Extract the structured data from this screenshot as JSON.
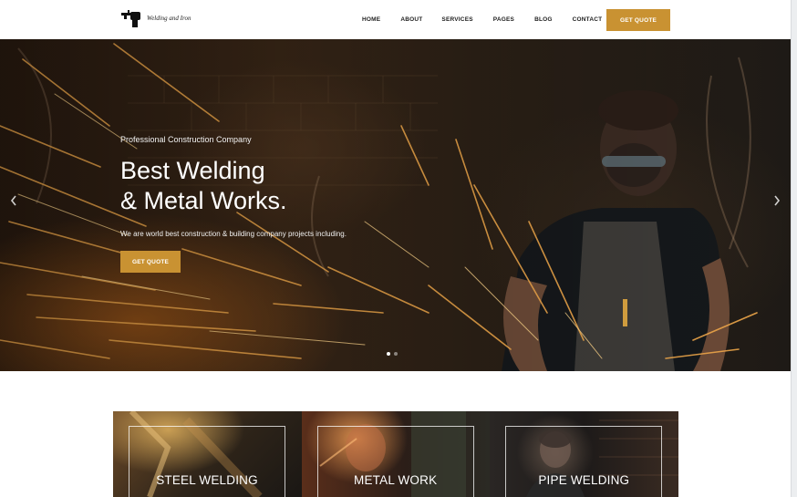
{
  "brand": {
    "name": "Welding and Iron",
    "logo_icon": "welder-logo-icon"
  },
  "nav": {
    "items": [
      {
        "label": "HOME"
      },
      {
        "label": "ABOUT"
      },
      {
        "label": "SERVICES"
      },
      {
        "label": "PAGES"
      },
      {
        "label": "BLOG"
      },
      {
        "label": "CONTACT"
      }
    ],
    "cta": "GET QUOTE"
  },
  "hero": {
    "eyebrow": "Professional Construction Company",
    "title_line1": "Best Welding",
    "title_line2": "& Metal Works.",
    "description": "We are world best construction & building company projects including.",
    "cta": "GET QUOTE",
    "prev_icon": "chevron-left-icon",
    "next_icon": "chevron-right-icon",
    "slides": 2,
    "active_slide": 1
  },
  "services": [
    {
      "title": "STEEL WELDING"
    },
    {
      "title": "METAL WORK"
    },
    {
      "title": "PIPE WELDING"
    }
  ],
  "colors": {
    "accent": "#c99232",
    "header_bg": "#ffffff",
    "nav_text": "#1e1e1e"
  }
}
